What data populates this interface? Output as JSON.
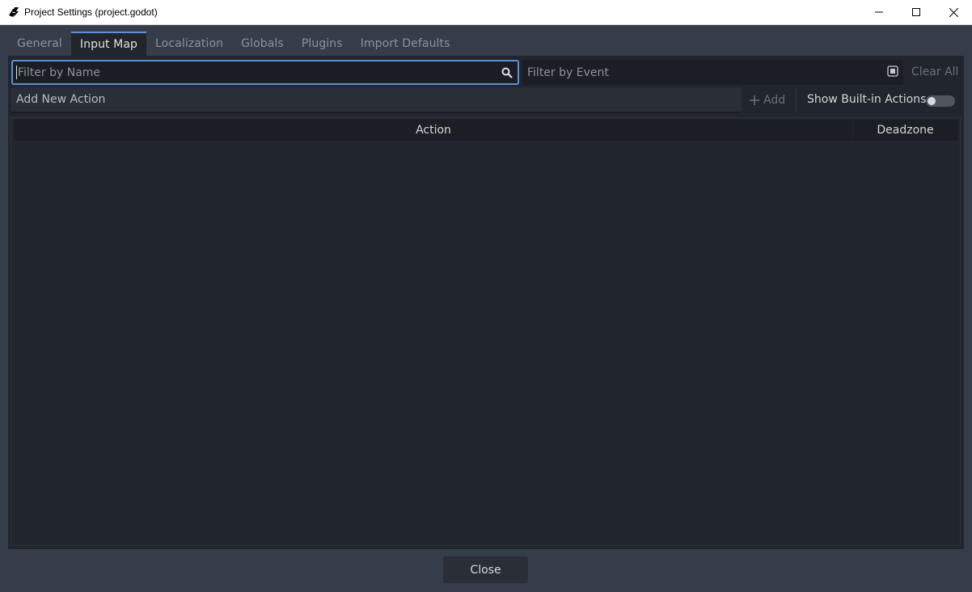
{
  "window": {
    "title": "Project Settings (project.godot)",
    "icons": [
      "godot-editor-icon",
      "minimize-icon",
      "maximize-icon",
      "close-icon"
    ]
  },
  "tabs": [
    {
      "label": "General"
    },
    {
      "label": "Input Map",
      "active": true
    },
    {
      "label": "Localization"
    },
    {
      "label": "Globals"
    },
    {
      "label": "Plugins"
    },
    {
      "label": "Import Defaults"
    }
  ],
  "filters": {
    "name_placeholder": "Filter by Name",
    "event_placeholder": "Filter by Event",
    "clear_all": "Clear All"
  },
  "actions_bar": {
    "add_new_placeholder": "Add New Action",
    "add_label": "Add",
    "show_builtin_label": "Show Built-in Actions",
    "show_builtin_enabled": false
  },
  "table": {
    "columns": [
      "Action",
      "Deadzone"
    ],
    "rows": []
  },
  "footer": {
    "close_label": "Close"
  },
  "colors": {
    "accent": "#5d8fd8",
    "background": "#363d4a",
    "panel": "#21252c"
  }
}
